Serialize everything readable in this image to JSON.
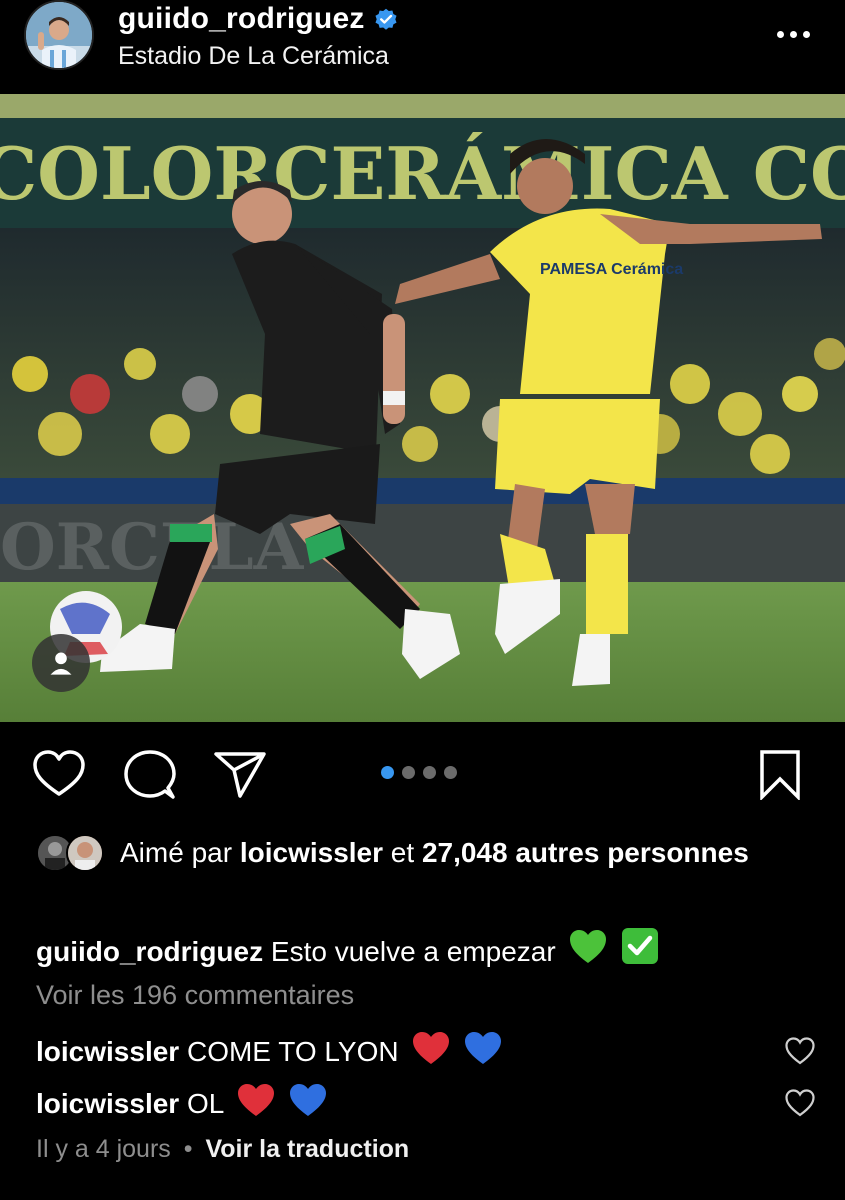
{
  "header": {
    "username": "guiido_rodriguez",
    "location": "Estadio De La Cerámica",
    "verified": true
  },
  "photo": {
    "banner_text": "COLORCERÁMICA COLORCERÁMICA COLOR",
    "sponsor_text": "PAMESA Cerámica",
    "kit_colors": {
      "home": "#f5e94a",
      "away": "#1c1c1c",
      "trim": "#2aa65a"
    }
  },
  "carousel": {
    "count": 4,
    "active_index": 0
  },
  "likes": {
    "prefix": "Aimé par",
    "liker": "loicwissler",
    "middle": "et",
    "count_text": "27,048 autres",
    "suffix": "personnes"
  },
  "caption": {
    "username": "guiido_rodriguez",
    "text": "Esto vuelve a empezar"
  },
  "view_comments": "Voir les 196 commentaires",
  "comments": [
    {
      "username": "loicwissler",
      "text": "COME TO LYON"
    },
    {
      "username": "loicwissler",
      "text": "OL"
    }
  ],
  "footer": {
    "time": "Il y a 4 jours",
    "separator": "•",
    "translate": "Voir la traduction"
  },
  "colors": {
    "accent": "#3897f0",
    "muted": "#8e8e8e",
    "heart_red": "#e0303a",
    "heart_blue": "#2f6fe0",
    "green_heart": "#4cc23a",
    "check_green": "#3ebd3a"
  }
}
